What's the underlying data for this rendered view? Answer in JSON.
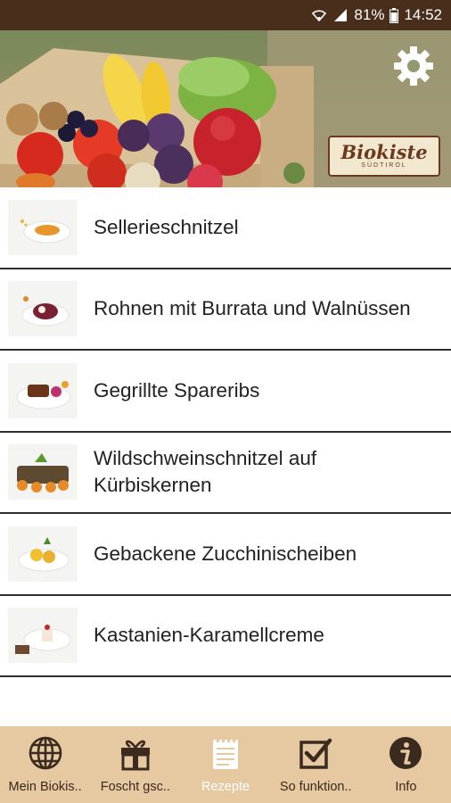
{
  "status_bar": {
    "battery_percent": "81%",
    "time": "14:52",
    "icons": [
      "wifi-icon",
      "signal-icon",
      "battery-icon"
    ]
  },
  "header": {
    "brand_name": "Biokiste",
    "brand_sub": "SÜDTIROL",
    "settings_icon": "gear-icon"
  },
  "recipes": [
    {
      "title": "Sellerieschnitzel",
      "thumb": "dish-thumbnail"
    },
    {
      "title": "Rohnen mit Burrata und Walnüssen",
      "thumb": "dish-thumbnail"
    },
    {
      "title": "Gegrillte Spareribs",
      "thumb": "dish-thumbnail"
    },
    {
      "title": "Wildschweinschnitzel auf Kürbiskernen",
      "thumb": "dish-thumbnail"
    },
    {
      "title": "Gebackene Zucchinischeiben",
      "thumb": "dish-thumbnail"
    },
    {
      "title": "Kastanien-Karamellcreme",
      "thumb": "dish-thumbnail"
    }
  ],
  "bottom_nav": [
    {
      "label": "Mein Biokis..",
      "icon": "globe-icon",
      "active": false
    },
    {
      "label": "Foscht gsc..",
      "icon": "gift-icon",
      "active": false
    },
    {
      "label": "Rezepte",
      "icon": "notepad-icon",
      "active": true
    },
    {
      "label": "So funktion..",
      "icon": "checkbox-icon",
      "active": false
    },
    {
      "label": "Info",
      "icon": "info-icon",
      "active": false
    }
  ],
  "colors": {
    "status_bar": "#4a2e1c",
    "nav_background": "#e6c9a1",
    "active_nav": "#ffffff",
    "divider": "#2f2f2f"
  }
}
